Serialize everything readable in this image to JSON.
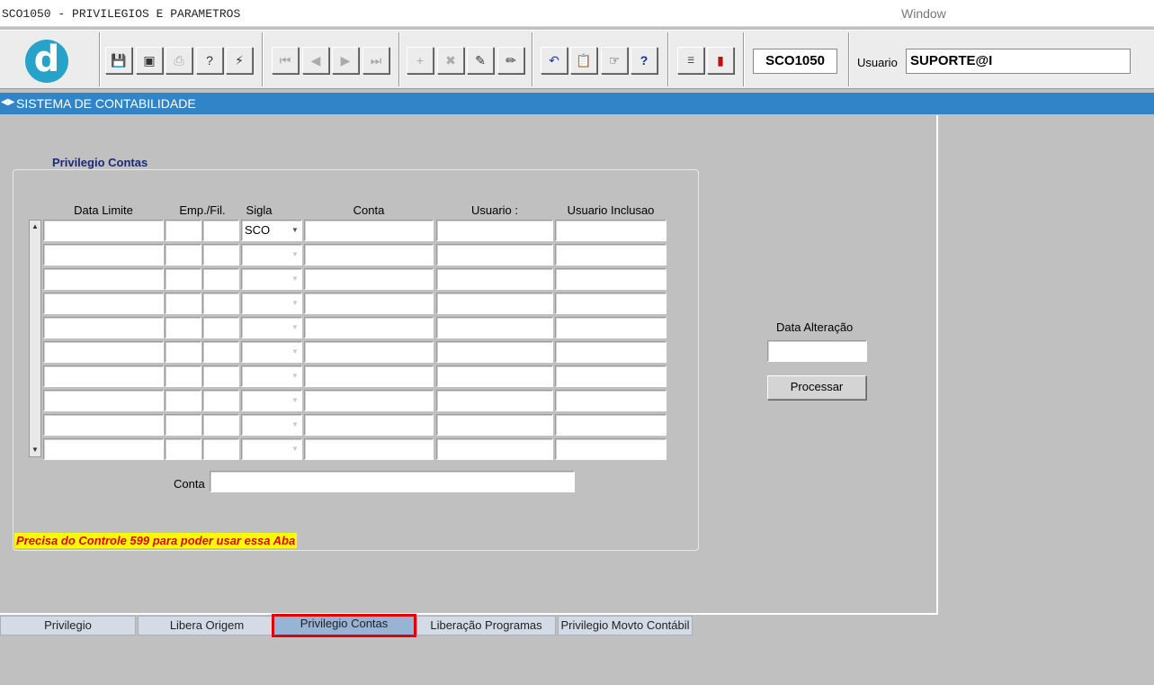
{
  "window": {
    "title": "SCO1050 - PRIVILEGIOS E PARAMETROS",
    "menu": "Window"
  },
  "toolbar": {
    "logo": "d",
    "icons": [
      "save-icon",
      "window-icon",
      "print-icon",
      "query-icon",
      "execute-icon",
      "first-record-icon",
      "previous-record-icon",
      "next-record-icon",
      "last-record-icon",
      "insert-record-icon",
      "delete-record-icon",
      "edit-icon",
      "clear-icon",
      "undo-icon",
      "clipboard-icon",
      "help-hand-icon",
      "help-icon",
      "menu-icon",
      "exit-icon"
    ],
    "form_code": "SCO1050",
    "user_label": "Usuario",
    "user_value": "SUPORTE@I"
  },
  "section": {
    "title": "SISTEMA DE CONTABILIDADE"
  },
  "frame": {
    "title": "Privilegio Contas",
    "columns": [
      "Data Limite",
      "Emp./Fil.",
      "Sigla",
      "Conta",
      "Usuario :",
      "Usuario Inclusao"
    ],
    "rows": [
      [
        "",
        "",
        "",
        "SCO",
        "",
        "",
        ""
      ],
      [
        "",
        "",
        "",
        "",
        "",
        "",
        ""
      ],
      [
        "",
        "",
        "",
        "",
        "",
        "",
        ""
      ],
      [
        "",
        "",
        "",
        "",
        "",
        "",
        ""
      ],
      [
        "",
        "",
        "",
        "",
        "",
        "",
        ""
      ],
      [
        "",
        "",
        "",
        "",
        "",
        "",
        ""
      ],
      [
        "",
        "",
        "",
        "",
        "",
        "",
        ""
      ],
      [
        "",
        "",
        "",
        "",
        "",
        "",
        ""
      ],
      [
        "",
        "",
        "",
        "",
        "",
        "",
        ""
      ],
      [
        "",
        "",
        "",
        "",
        "",
        "",
        ""
      ]
    ],
    "conta_label": "Conta",
    "conta_value": "",
    "warning": "Precisa do Controle 599 para poder usar essa Aba"
  },
  "side": {
    "data_alteracao_label": "Data Alteração",
    "data_alteracao_value": "",
    "process_button": "Processar"
  },
  "tabs": [
    {
      "label": "Privilegio",
      "active": false
    },
    {
      "label": "Libera Origem",
      "active": false
    },
    {
      "label": "Privilegio Contas",
      "active": true
    },
    {
      "label": "Liberação Programas",
      "active": false
    },
    {
      "label": "Privilegio Movto Contábil",
      "active": false
    }
  ]
}
